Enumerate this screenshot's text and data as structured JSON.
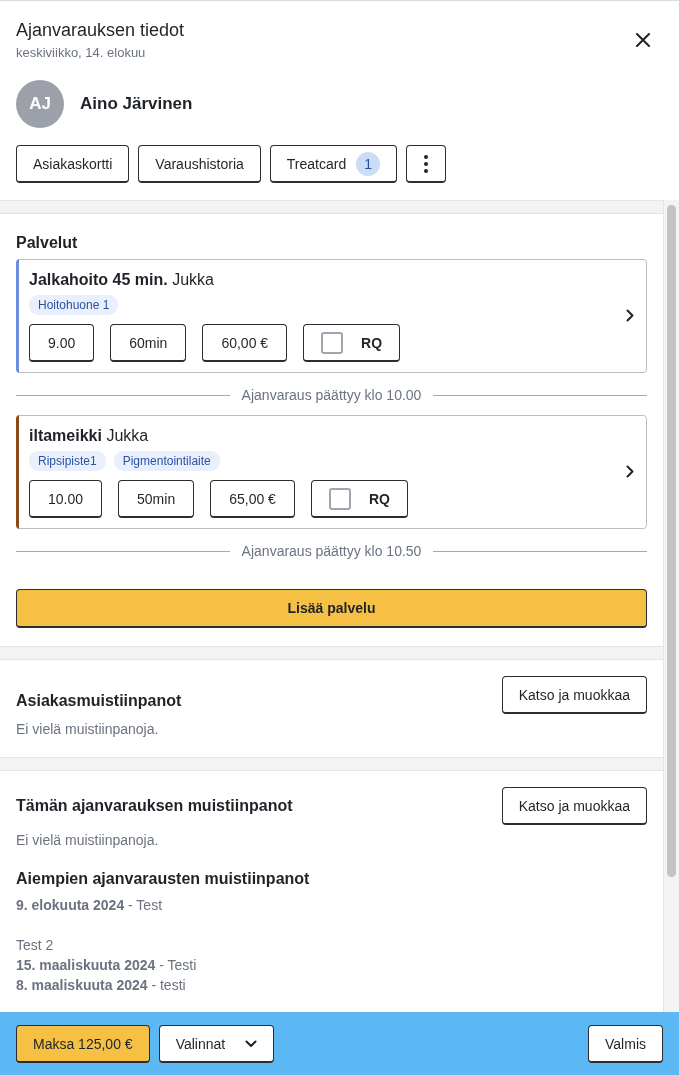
{
  "header": {
    "title": "Ajanvarauksen tiedot",
    "subtitle": "keskiviikko, 14. elokuu"
  },
  "customer": {
    "initials": "AJ",
    "name": "Aino Järvinen"
  },
  "actions": [
    {
      "kind": "button",
      "label": "Asiakaskortti"
    },
    {
      "kind": "button",
      "label": "Varaushistoria"
    },
    {
      "kind": "button",
      "label": "Treatcard",
      "badge": "1"
    },
    {
      "kind": "menu"
    }
  ],
  "services": {
    "title": "Palvelut",
    "items": [
      {
        "name": "Jalkahoito 45 min.",
        "staff": "Jukka",
        "color": "#6b8ee0",
        "resources": [
          "Hoitohuone 1"
        ],
        "time": "9.00",
        "duration": "60min",
        "price": "60,00 €",
        "rq": {
          "label": "RQ",
          "checked": false
        },
        "end_note": "Ajanvaraus päättyy klo 10.00"
      },
      {
        "name": "iltameikki",
        "staff": "Jukka",
        "color": "#8b4a18",
        "resources": [
          "Ripsipiste1",
          "Pigmentointilaite"
        ],
        "time": "10.00",
        "duration": "50min",
        "price": "65,00 €",
        "rq": {
          "label": "RQ",
          "checked": false
        },
        "end_note": "Ajanvaraus päättyy klo 10.50"
      }
    ],
    "add_button": "Lisää palvelu"
  },
  "customer_notes": {
    "title": "Asiakasmuistiinpanot",
    "button": "Katso ja muokkaa",
    "empty_text": "Ei vielä muistiinpanoja."
  },
  "booking_notes": {
    "title": "Tämän ajanvarauksen muistiinpanot",
    "button": "Katso ja muokkaa",
    "empty_text": "Ei vielä muistiinpanoja.",
    "previous": {
      "title": "Aiempien ajanvarausten muistiinpanot",
      "notes": [
        "**9. elokuuta 2024** - Test\n\nTest 2",
        "**15. maaliskuuta 2024** - Testi",
        "**8. maaliskuuta 2024** - testi"
      ]
    }
  },
  "footer": {
    "pay_button": "Maksa 125,00 €",
    "options_button": "Valinnat",
    "done_button": "Valmis"
  }
}
